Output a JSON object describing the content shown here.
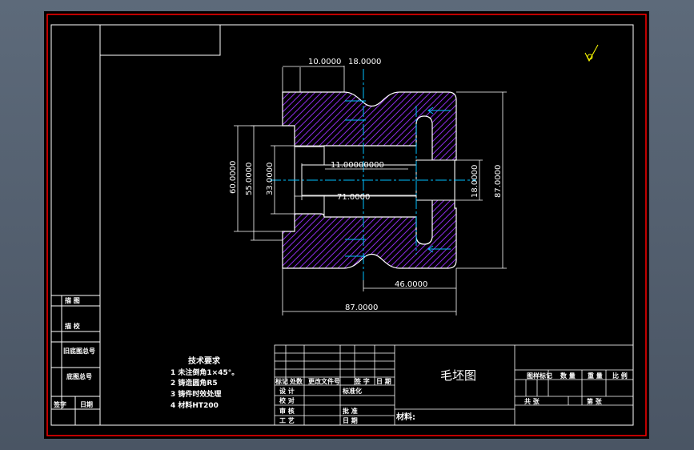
{
  "colors": {
    "background": "#000000",
    "border": "#ff0000",
    "linework": "#ffffff",
    "hatch": "#8a2be2",
    "centerline": "#00bfff",
    "dimension": "#ffffff",
    "symbol": "#ffff00"
  },
  "dimensions": {
    "top_left_width": "10.0000",
    "top_slot_width": "18.0000",
    "left_outer_height": "60.0000",
    "left_inner_height": "55.0000",
    "bore_height": "33.0000",
    "bore_length": "11.0000",
    "bore_length_suffix": "0000",
    "inner_length": "71.0000",
    "right_small_height": "18.0000",
    "total_height": "87.0000",
    "right_step_width": "46.0000",
    "total_width": "87.0000"
  },
  "left_column": [
    "描 图",
    "描 校",
    "旧底图总号",
    "底图总号",
    "签字",
    "日期"
  ],
  "tech_requirements": {
    "title": "技术要求",
    "items": [
      "1 未注倒角1×45°。",
      "2 铸造圆角R5",
      "3 铸件时效处理",
      "4 材料HT200"
    ]
  },
  "title_block": {
    "part_name": "毛坯图",
    "material_label": "材料:",
    "header_row": [
      "标记",
      "处数",
      "更改文件号",
      "签 字",
      "日 期"
    ],
    "roles": [
      "设 计",
      "校 对",
      "审 核",
      "工 艺"
    ],
    "mid_labels": [
      "标准化",
      "批 准",
      "日 期"
    ],
    "right_labels": [
      "图样标记",
      "数 量",
      "重 量",
      "比 例"
    ],
    "bottom_labels": [
      "共 张",
      "第 张"
    ]
  },
  "icon": "surface-finish-symbol-icon"
}
